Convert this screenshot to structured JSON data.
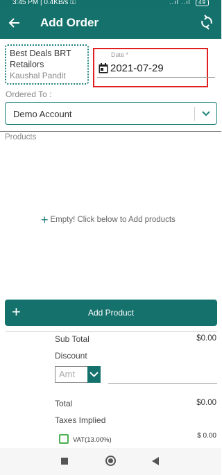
{
  "status_bar": {
    "time_info": "3:45 PM | 0.4KB/s ⚿",
    "signal": "..ıl ..ıl",
    "battery": "49"
  },
  "app_bar": {
    "title": "Add Order",
    "back_icon": "arrow-left-icon",
    "sync_icon": "sync-icon"
  },
  "shop": {
    "name": "Best Deals BRT Retailors",
    "owner": "Kaushal Pandit"
  },
  "date_field": {
    "label": "Date *",
    "value": "2021-07-29",
    "icon": "calendar-icon"
  },
  "ordered_to": {
    "label": "Ordered To :",
    "selected": "Demo Account"
  },
  "products": {
    "label": "Products",
    "empty_text": "Empty! Click below to Add products"
  },
  "add_product": {
    "label": "Add Product"
  },
  "summary": {
    "sub_total_label": "Sub Total",
    "sub_total_value": "$0.00",
    "discount_label": "Discount",
    "discount_placeholder": "Amt",
    "total_label": "Total",
    "total_value": "$0.00",
    "taxes_label": "Taxes Implied",
    "vat_label": "VAT(13.00%)",
    "vat_value": "$ 0.00"
  },
  "colors": {
    "primary": "#15716c",
    "highlight_box": "#e02020",
    "checkbox": "#4caf50"
  }
}
